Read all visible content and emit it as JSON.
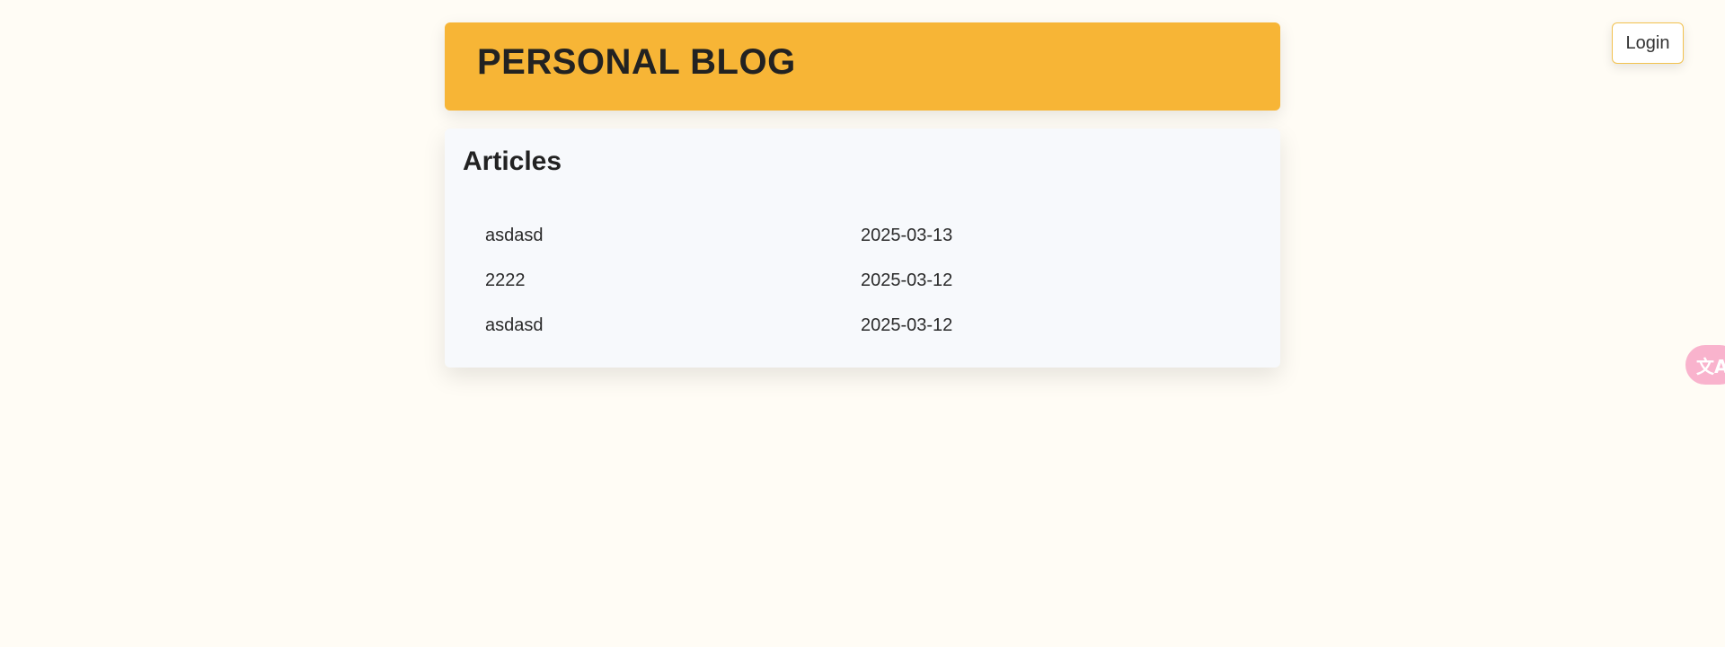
{
  "header": {
    "title": "PERSONAL BLOG"
  },
  "login_button": {
    "label": "Login"
  },
  "articles": {
    "heading": "Articles",
    "items": [
      {
        "title": "asdasd",
        "date": "2025-03-13"
      },
      {
        "title": "2222",
        "date": "2025-03-12"
      },
      {
        "title": "asdasd",
        "date": "2025-03-12"
      }
    ]
  },
  "translate_widget": {
    "icon": "translate-icon",
    "glyph": "文A",
    "color": "#f9b3cd"
  },
  "colors": {
    "page_background": "#fffcf5",
    "header_background": "#f7b536",
    "card_background": "#f7f9fc",
    "login_border": "#f2c24f"
  }
}
